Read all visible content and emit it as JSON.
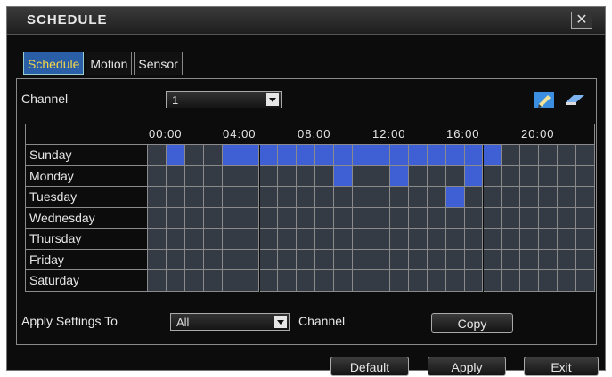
{
  "window": {
    "title": "SCHEDULE",
    "close_glyph": "✕"
  },
  "tabs": [
    {
      "label": "Schedule",
      "active": true
    },
    {
      "label": "Motion",
      "active": false
    },
    {
      "label": "Sensor",
      "active": false
    }
  ],
  "channel": {
    "label": "Channel",
    "value": "1"
  },
  "tools": {
    "pencil_icon": "pencil-icon",
    "eraser_icon": "eraser-icon"
  },
  "time_labels": [
    "00:00",
    "04:00",
    "08:00",
    "12:00",
    "16:00",
    "20:00"
  ],
  "days": [
    "Sunday",
    "Monday",
    "Tuesday",
    "Wednesday",
    "Thursday",
    "Friday",
    "Saturday"
  ],
  "schedule": {
    "Sunday": [
      1,
      4,
      5,
      6,
      7,
      8,
      9,
      10,
      11,
      12,
      13,
      14,
      15,
      16,
      17,
      18
    ],
    "Monday": [
      10,
      13,
      17
    ],
    "Tuesday": [
      16
    ],
    "Wednesday": [],
    "Thursday": [],
    "Friday": [],
    "Saturday": []
  },
  "apply": {
    "label": "Apply Settings To",
    "value": "All",
    "suffix": "Channel",
    "copy_label": "Copy"
  },
  "footer": {
    "default_label": "Default",
    "apply_label": "Apply",
    "exit_label": "Exit"
  },
  "colors": {
    "active_cell": "#3f5fd4",
    "inactive_cell": "#353b44",
    "tab_active_bg": "#2a5fa8",
    "tab_active_text": "#f6d64a"
  }
}
